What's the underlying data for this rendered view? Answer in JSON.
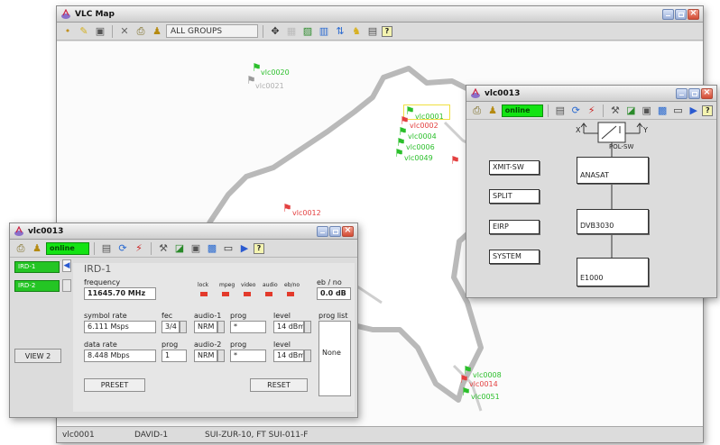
{
  "main": {
    "title": "VLC Map",
    "toolbar": {
      "groups_value": "ALL GROUPS"
    },
    "map_labels": [
      {
        "text": "vlc0020",
        "color": "#2bbf2b"
      },
      {
        "text": "vlc0021",
        "color": "#b0b0b0"
      },
      {
        "text": "vlc0001",
        "color": "#2bbf2b"
      },
      {
        "text": "vlc0002",
        "color": "#e34040"
      },
      {
        "text": "vlc0004",
        "color": "#2bbf2b"
      },
      {
        "text": "vlc0006",
        "color": "#2bbf2b"
      },
      {
        "text": "vlc0049",
        "color": "#2bbf2b"
      },
      {
        "text": "vlc0012",
        "color": "#e34040"
      },
      {
        "text": "vlc0008",
        "color": "#2bbf2b"
      },
      {
        "text": "vlc0014",
        "color": "#e34040"
      },
      {
        "text": "vlc0051",
        "color": "#2bbf2b"
      }
    ],
    "status": {
      "device": "vlc0001",
      "name": "DAVID-1",
      "location": "SUI-ZUR-10, FT SUI-011-F"
    }
  },
  "ird_window": {
    "title": "vlc0013",
    "online_label": "online",
    "ird_tabs": [
      "IRD-1",
      "IRD-2"
    ],
    "view_button": "VIEW 2",
    "heading": "IRD-1",
    "frequency": {
      "label": "frequency",
      "value": "11645.70 MHz"
    },
    "led_labels": [
      "lock",
      "mpeg",
      "video",
      "audio",
      "eb/no"
    ],
    "ebno": {
      "label": "eb / no",
      "value": "0.0 dB"
    },
    "symbol_rate": {
      "label": "symbol rate",
      "value": "6.111 Msps"
    },
    "fec": {
      "label": "fec",
      "value": "3/4"
    },
    "audio1": {
      "label": "audio-1",
      "value": "NRM"
    },
    "prog1": {
      "label": "prog",
      "value": "*"
    },
    "level1": {
      "label": "level",
      "value": "14 dBm"
    },
    "prog_list": {
      "label": "prog list",
      "value": "None"
    },
    "data_rate": {
      "label": "data rate",
      "value": "8.448 Mbps"
    },
    "prog_num": {
      "label": "prog",
      "value": "1"
    },
    "audio2": {
      "label": "audio-2",
      "value": "NRM"
    },
    "prog2": {
      "label": "prog",
      "value": "*"
    },
    "level2": {
      "label": "level",
      "value": "14 dBm"
    },
    "reset_left": "PRESET",
    "reset_right": "RESET"
  },
  "diagram_window": {
    "title": "vlc0013",
    "online_label": "online",
    "switch_labels": {
      "x": "X",
      "y": "Y",
      "pol": "POL-SW"
    },
    "side_buttons": [
      "XMIT-SW",
      "SPLIT",
      "EIRP",
      "SYSTEM"
    ],
    "chain": [
      "ANASAT",
      "DVB3030",
      "E1000"
    ]
  },
  "colors": {
    "online_green": "#13e313",
    "alarm_red": "#e33a2b",
    "map_gray": "#b9b9b9"
  }
}
